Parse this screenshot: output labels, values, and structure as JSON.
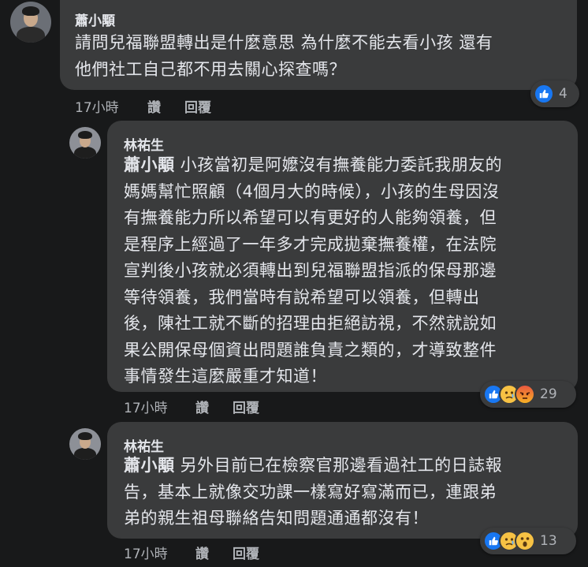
{
  "comments": [
    {
      "author": "蕭小顒",
      "lines": [
        "請問兒福聯盟轉出是什麼意思 為什麼不能去看小孩 還有",
        "他們社工自己都不用去關心探查嗎？"
      ],
      "time": "17小時",
      "like_label": "讚",
      "reply_label": "回覆",
      "reaction_count": "4",
      "reactions": [
        "like-icon"
      ]
    },
    {
      "author": "林祐生",
      "mention": "蕭小顒",
      "lines": [
        " 小孩當初是阿嬤沒有撫養能力委託我朋友的",
        "媽媽幫忙照顧（4個月大的時候），小孩的生母因沒",
        "有撫養能力所以希望可以有更好的人能夠領養，但",
        "是程序上經過了一年多才完成拋棄撫養權，在法院",
        "宣判後小孩就必須轉出到兒福聯盟指派的保母那邊",
        "等待領養，我們當時有說希望可以領養，但轉出",
        "後，陳社工就不斷的招理由拒絕訪視，不然就說如",
        "果公開保母個資出問題誰負責之類的，才導致整件",
        "事情發生這麼嚴重才知道！"
      ],
      "time": "17小時",
      "like_label": "讚",
      "reply_label": "回覆",
      "reaction_count": "29",
      "reactions": [
        "like-icon",
        "sad-icon",
        "angry-icon"
      ]
    },
    {
      "author": "林祐生",
      "mention": "蕭小顒",
      "lines": [
        " 另外目前已在檢察官那邊看過社工的日誌報",
        "告，基本上就像交功課一樣寫好寫滿而已，連跟弟",
        "弟的親生祖母聯絡告知問題通通都沒有！"
      ],
      "time": "17小時",
      "like_label": "讚",
      "reply_label": "回覆",
      "reaction_count": "13",
      "reactions": [
        "like-icon",
        "sad-icon",
        "wow-icon"
      ]
    }
  ]
}
